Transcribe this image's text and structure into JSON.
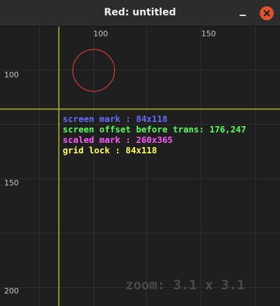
{
  "window": {
    "title": "Red: untitled"
  },
  "titlebar": {
    "minimize_icon": "minimize-icon",
    "close_icon": "close-icon",
    "close_color": "#e0532d"
  },
  "rulers": {
    "x_labels": [
      "100",
      "150"
    ],
    "y_labels": [
      "100",
      "150",
      "200"
    ]
  },
  "canvas": {
    "crosshair_color": "#b8b23a",
    "circle_color": "#d63a3a",
    "grid_color": "#2e2e2e"
  },
  "info": {
    "screen_mark": "screen mark : 84x118",
    "screen_offset": "screen offset before trans: 176,247",
    "scaled_mark": "scaled mark : 260x365",
    "grid_lock": "grid lock : 84x118",
    "colors": {
      "screen_mark": "#6a6aff",
      "screen_offset": "#59ff59",
      "scaled_mark": "#ff59ff",
      "grid_lock": "#ffff59"
    }
  },
  "zoom_text": "zoom: 3.1 x 3.1"
}
